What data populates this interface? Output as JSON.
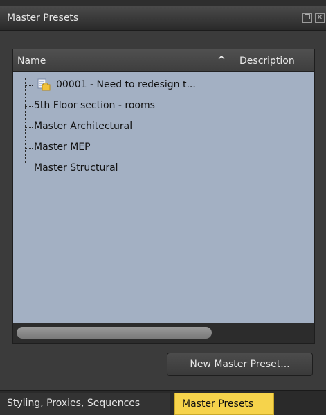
{
  "panel": {
    "title": "Master Presets",
    "float_icon": "float-window-icon",
    "close_icon": "close-icon"
  },
  "columns": {
    "name": "Name",
    "description": "Description",
    "sort": "ascending"
  },
  "tree": {
    "items": [
      {
        "label": "00001 - Need to redesign t...",
        "icon": "preset-document-icon"
      },
      {
        "label": "5th Floor section - rooms"
      },
      {
        "label": "Master Architectural"
      },
      {
        "label": "Master MEP"
      },
      {
        "label": "Master Structural"
      }
    ]
  },
  "buttons": {
    "new_master_preset": "New Master Preset..."
  },
  "tabs": [
    {
      "label": "Styling, Proxies, Sequences",
      "active": false
    },
    {
      "label": "Master Presets",
      "active": true
    }
  ],
  "colors": {
    "tree_background": "#a3b0c3",
    "active_tab": "#f6d34b",
    "panel_background": "#3b3b3b"
  }
}
